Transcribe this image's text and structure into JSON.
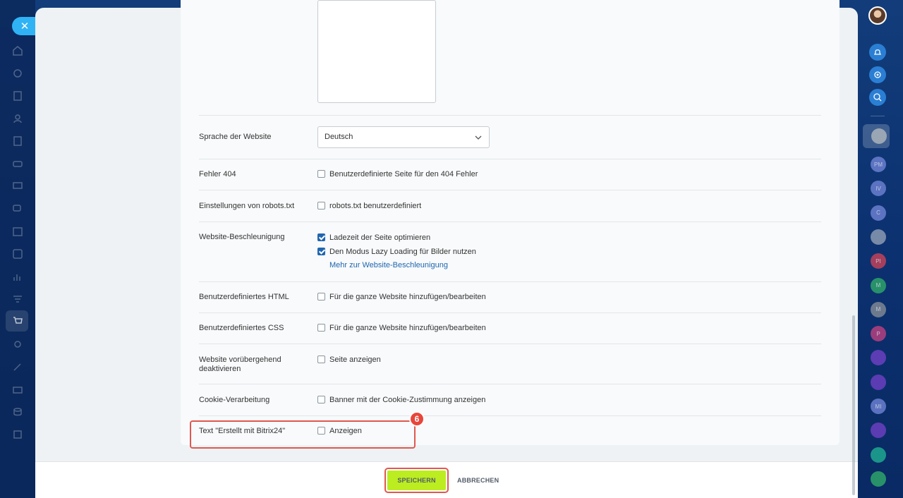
{
  "form": {
    "language": {
      "label": "Sprache der Website",
      "value": "Deutsch"
    },
    "error404": {
      "label": "Fehler 404",
      "option": "Benutzerdefinierte Seite für den 404 Fehler",
      "checked": false
    },
    "robots": {
      "label": "Einstellungen von robots.txt",
      "option": "robots.txt benutzerdefiniert",
      "checked": false
    },
    "acceleration": {
      "label": "Website-Beschleunigung",
      "options": [
        {
          "text": "Ladezeit der Seite optimieren",
          "checked": true
        },
        {
          "text": "Den Modus Lazy Loading für Bilder nutzen",
          "checked": true
        }
      ],
      "link": "Mehr zur Website-Beschleunigung"
    },
    "custom_html": {
      "label": "Benutzerdefiniertes HTML",
      "option": "Für die ganze Website hinzufügen/bearbeiten",
      "checked": false
    },
    "custom_css": {
      "label": "Benutzerdefiniertes CSS",
      "option": "Für die ganze Website hinzufügen/bearbeiten",
      "checked": false
    },
    "deactivate": {
      "label": "Website vorübergehend deaktivieren",
      "option": "Seite anzeigen",
      "checked": false
    },
    "cookie": {
      "label": "Cookie-Verarbeitung",
      "option": "Banner mit der Cookie-Zustimmung anzeigen",
      "checked": false
    },
    "bitrix_text": {
      "label": "Text \"Erstellt mit Bitrix24\"",
      "option": "Anzeigen",
      "checked": false
    }
  },
  "annotation": {
    "step": "6"
  },
  "footer": {
    "save_label": "SPEICHERN",
    "cancel_label": "ABBRECHEN"
  },
  "right_rail": {
    "avatars": [
      {
        "initials": "PM",
        "color": "#6a7fd0"
      },
      {
        "initials": "IV",
        "color": "#6a7fd0"
      },
      {
        "initials": "C",
        "color": "#6a7fd0"
      },
      {
        "initials": "",
        "color": "#8b9ab0"
      },
      {
        "initials": "PI",
        "color": "#c0425a"
      },
      {
        "initials": "M",
        "color": "#2ea36a"
      },
      {
        "initials": "M",
        "color": "#7f8894"
      },
      {
        "initials": "P",
        "color": "#b5407f"
      },
      {
        "initials": "",
        "color": "#6b3fbf"
      },
      {
        "initials": "",
        "color": "#6b3fbf"
      },
      {
        "initials": "MI",
        "color": "#6a7fd0"
      },
      {
        "initials": "",
        "color": "#6b3fbf"
      },
      {
        "initials": "",
        "color": "#1ea890"
      },
      {
        "initials": "",
        "color": "#2ea36a"
      }
    ]
  },
  "colors": {
    "accent": "#bbed21",
    "highlight": "#e0584f",
    "link": "#2067b0"
  }
}
